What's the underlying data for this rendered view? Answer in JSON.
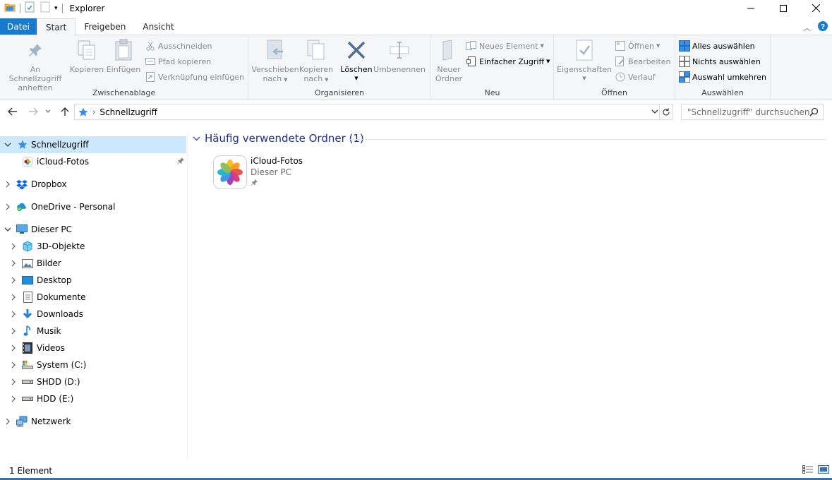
{
  "window": {
    "title": "Explorer"
  },
  "ribbon_tabs": {
    "file": "Datei",
    "start": "Start",
    "share": "Freigeben",
    "view": "Ansicht"
  },
  "ribbon": {
    "clipboard": {
      "label": "Zwischenablage",
      "pin_quick_access": [
        "An Schnellzugriff",
        "anheften"
      ],
      "copy": "Kopieren",
      "paste": "Einfügen",
      "cut": "Ausschneiden",
      "copy_path": "Pfad kopieren",
      "paste_shortcut": "Verknüpfung einfügen"
    },
    "organize": {
      "label": "Organisieren",
      "move_to": [
        "Verschieben",
        "nach"
      ],
      "copy_to": [
        "Kopieren",
        "nach"
      ],
      "delete": "Löschen",
      "rename": "Umbenennen"
    },
    "new": {
      "label": "Neu",
      "new_folder": [
        "Neuer",
        "Ordner"
      ],
      "new_item": "Neues Element",
      "easy_access": "Einfacher Zugriff"
    },
    "open": {
      "label": "Öffnen",
      "properties": "Eigenschaften",
      "open": "Öffnen",
      "edit": "Bearbeiten",
      "history": "Verlauf"
    },
    "select": {
      "label": "Auswählen",
      "select_all": "Alles auswählen",
      "select_none": "Nichts auswählen",
      "invert": "Auswahl umkehren"
    }
  },
  "address": {
    "crumb": "Schnellzugriff",
    "search_placeholder": "\"Schnellzugriff\" durchsuchen"
  },
  "nav": {
    "quick_access": "Schnellzugriff",
    "icloud_photos": "iCloud-Fotos",
    "dropbox": "Dropbox",
    "onedrive": "OneDrive - Personal",
    "this_pc": "Dieser PC",
    "pc_items": [
      "3D-Objekte",
      "Bilder",
      "Desktop",
      "Dokumente",
      "Downloads",
      "Musik",
      "Videos",
      "System (C:)",
      "SHDD (D:)",
      "HDD (E:)"
    ],
    "network": "Netzwerk"
  },
  "content": {
    "section_title": "Häufig verwendete Ordner (1)",
    "folder": {
      "name": "iCloud-Fotos",
      "location": "Dieser PC"
    }
  },
  "status": {
    "count": "1 Element"
  },
  "colors": {
    "accent": "#1979ca",
    "selection": "#cce8ff",
    "section_title": "#1e3287"
  }
}
